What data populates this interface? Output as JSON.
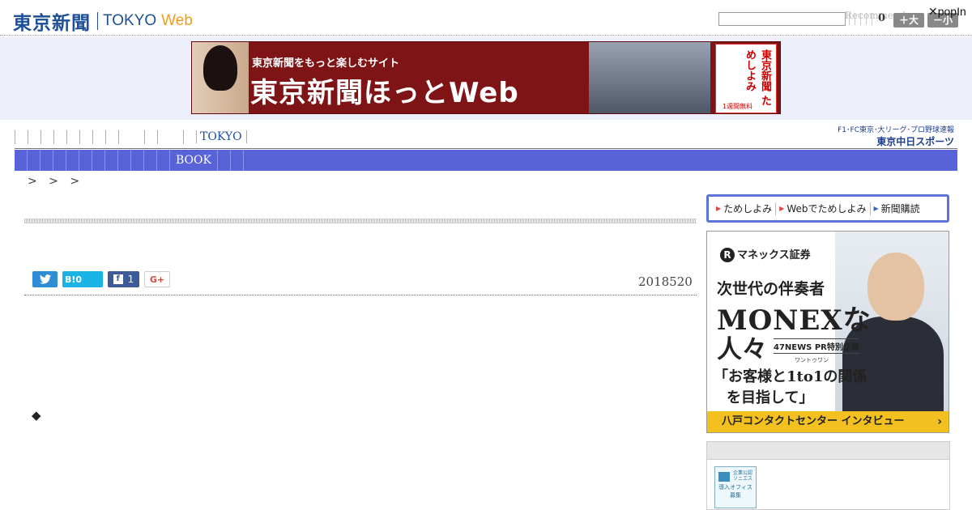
{
  "header": {
    "logo_main": "東京新聞",
    "logo_tokyo": "TOKYO",
    "logo_web": "Web",
    "search_placeholder": "",
    "recommend_text": "Recommend",
    "count": "0",
    "size_large_label": "＋大",
    "size_small_label": "－小",
    "popin_label": "✕popIn"
  },
  "banner": {
    "subtitle": "東京新聞をもっと楽しむサイト",
    "title": "東京新聞ほっとWeb",
    "book_text": "東京新聞 ためしよみ",
    "book_note": "1週間無料"
  },
  "nav": {
    "tokyo_label": "TOKYO",
    "book_label": "BOOK",
    "chunichi_top": "F1･FC東京･大リーグ･プロ野球速報",
    "chunichi_logo": "東京中日スポーツ"
  },
  "breadcrumb": {
    "text": ">   > >"
  },
  "article": {
    "date": "2018520",
    "share": {
      "twitter_icon": "twitter-bird",
      "hatena_label": "B!0",
      "facebook_count": "1",
      "facebook_icon": "f",
      "gplus_label": "G+"
    },
    "bullet": "◆"
  },
  "sidebar": {
    "nav_items": [
      "ためしよみ",
      "Webでためしよみ",
      "新聞購読"
    ],
    "ad": {
      "brand": "マネックス証券",
      "brand_mark": "R",
      "line1": "次世代の伴奏者",
      "line2": "MONEXな",
      "line3": "人々",
      "pr_label": "47NEWS PR特別企画",
      "ruby": "ワントゥワン",
      "quote1": "「お客様と1to1の関係",
      "quote2": "を目指して」",
      "footer": "八戸コンタクトセンター インタビュー",
      "footer_arrow": "›"
    },
    "badge": {
      "tag": "企業公認 ソニエス",
      "text": "導入オフィス 募集"
    }
  },
  "colors": {
    "brand_blue": "#1c4f97",
    "web_orange": "#f09c1a",
    "nav_bar": "#5863d8",
    "banner_red": "#7e1416",
    "ad_footer": "#f2c01f"
  }
}
